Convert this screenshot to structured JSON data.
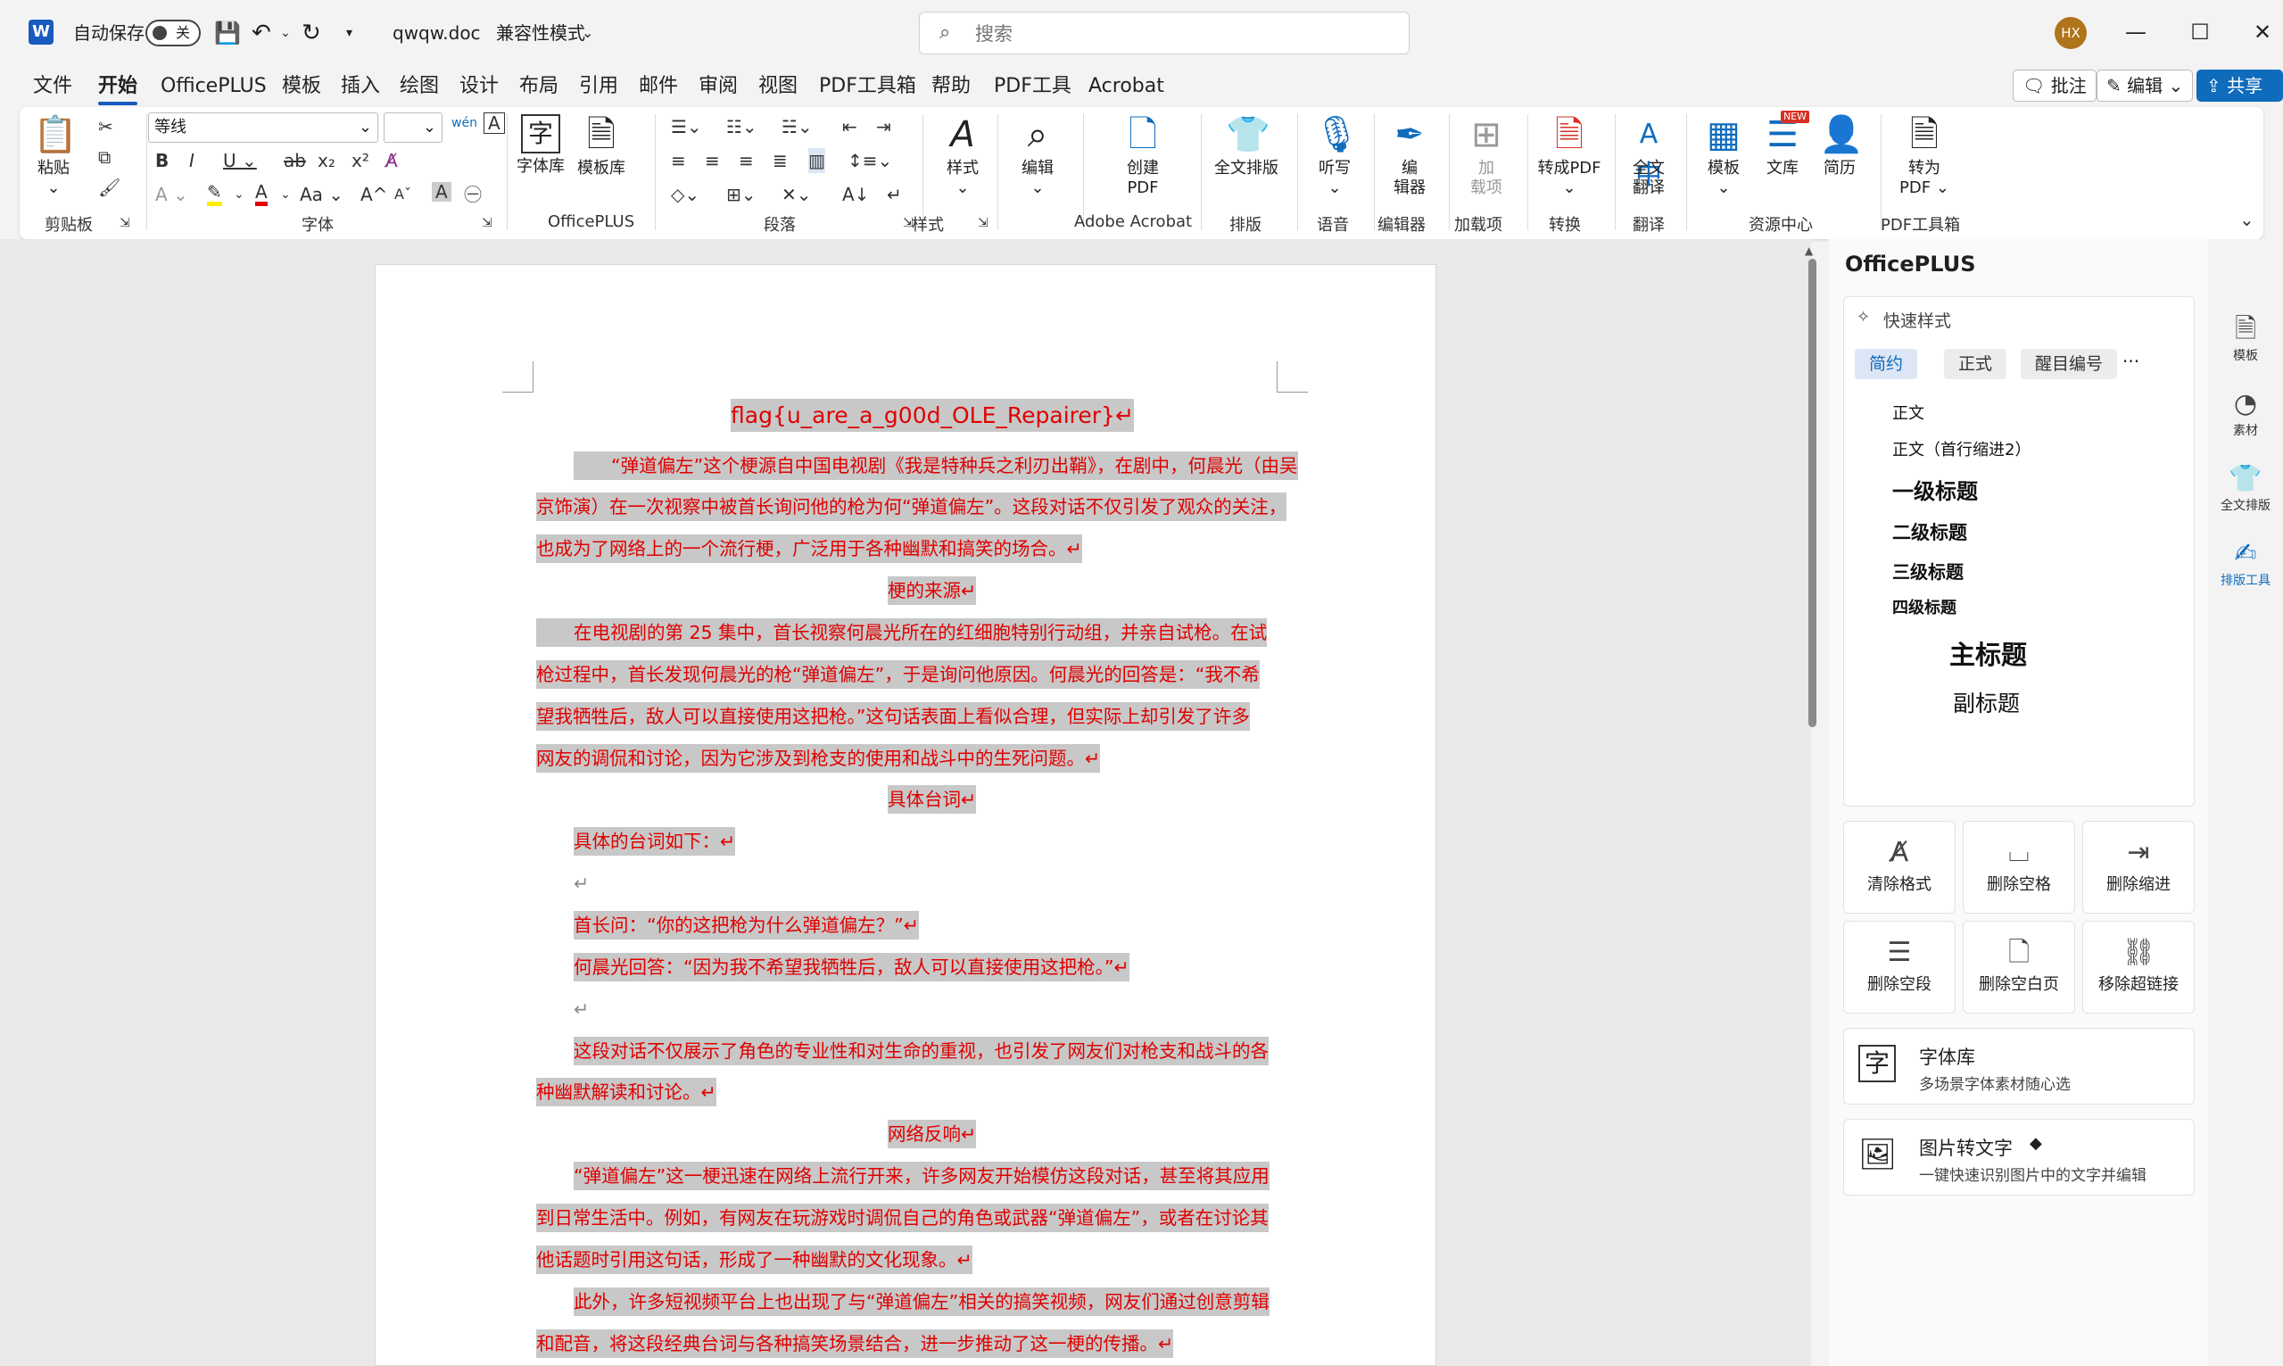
{
  "titlebar": {
    "autosave_label": "自动保存",
    "autosave_state": "关",
    "filename": "qwqw.doc",
    "mode": "兼容性模式",
    "search_placeholder": "搜索",
    "avatar_initials": "HX"
  },
  "menu": {
    "tabs": [
      "文件",
      "开始",
      "OfficePLUS",
      "模板",
      "插入",
      "绘图",
      "设计",
      "布局",
      "引用",
      "邮件",
      "审阅",
      "视图",
      "PDF工具箱",
      "帮助",
      "PDF工具",
      "Acrobat"
    ],
    "active": "开始",
    "comment_btn": "批注",
    "edit_btn": "编辑",
    "share_btn": "共享"
  },
  "ribbon": {
    "clipboard": {
      "paste": "粘贴",
      "label": "剪贴板"
    },
    "font": {
      "name": "等线",
      "size": "",
      "label": "字体"
    },
    "officeplus": {
      "fontlib": "字体库",
      "templatelib": "模板库",
      "label": "OfficePLUS"
    },
    "paragraph": {
      "label": "段落"
    },
    "styles": {
      "btn": "样式",
      "label": "样式"
    },
    "editing": {
      "btn": "编辑"
    },
    "acrobat": {
      "btn_line1": "创建",
      "btn_line2": "PDF",
      "label": "Adobe Acrobat"
    },
    "layout": {
      "btn": "全文排版",
      "label": "排版"
    },
    "voice": {
      "btn": "听写",
      "label": "语音"
    },
    "editor": {
      "btn_line1": "编",
      "btn_line2": "辑器",
      "label": "编辑器"
    },
    "addins": {
      "btn_line1": "加",
      "btn_line2": "载项",
      "label": "加载项"
    },
    "convert": {
      "btn": "转成PDF",
      "label": "转换"
    },
    "translate": {
      "btn_line1": "全文",
      "btn_line2": "翻译",
      "label": "翻译"
    },
    "resources": {
      "templates": "模板",
      "library": "文库",
      "resume": "简历",
      "label": "资源中心",
      "new_badge": "NEW"
    },
    "pdftools": {
      "btn_line1": "转为",
      "btn_line2": "PDF",
      "label": "PDF工具箱"
    }
  },
  "document": {
    "lines": [
      {
        "text": "flag{u_are_a_g00d_OLE_Repairer}↵"
      },
      {
        "text": "“弹道偏左”这个梗源自中国电视剧《我是特种兵之利刃出鞘》，在剧中，何晨光（由吴"
      },
      {
        "text": "京饰演）在一次视察中被首长询问他的枪为何“弹道偏左”。这段对话不仅引发了观众的关注，"
      },
      {
        "text": "也成为了网络上的一个流行梗，广泛用于各种幽默和搞笑的场合。↵"
      },
      {
        "text": "梗的来源↵"
      },
      {
        "text": "在电视剧的第 25 集中，首长视察何晨光所在的红细胞特别行动组，并亲自试枪。在试"
      },
      {
        "text": "枪过程中，首长发现何晨光的枪“弹道偏左”，于是询问他原因。何晨光的回答是：“我不希"
      },
      {
        "text": "望我牺牲后，敌人可以直接使用这把枪。”这句话表面上看似合理，但实际上却引发了许多"
      },
      {
        "text": "网友的调侃和讨论，因为它涉及到枪支的使用和战斗中的生死问题。↵"
      },
      {
        "text": "具体台词↵"
      },
      {
        "text": "具体的台词如下：↵"
      },
      {
        "text": "↵"
      },
      {
        "text": "首长问：“你的这把枪为什么弹道偏左？”↵"
      },
      {
        "text": "何晨光回答：“因为我不希望我牺牲后，敌人可以直接使用这把枪。”↵"
      },
      {
        "text": "↵"
      },
      {
        "text": "这段对话不仅展示了角色的专业性和对生命的重视，也引发了网友们对枪支和战斗的各"
      },
      {
        "text": "种幽默解读和讨论。↵"
      },
      {
        "text": "网络反响↵"
      },
      {
        "text": "“弹道偏左”这一梗迅速在网络上流行开来，许多网友开始模仿这段对话，甚至将其应用"
      },
      {
        "text": "到日常生活中。例如，有网友在玩游戏时调侃自己的角色或武器“弹道偏左”，或者在讨论其"
      },
      {
        "text": "他话题时引用这句话，形成了一种幽默的文化现象。↵"
      },
      {
        "text": "此外，许多短视频平台上也出现了与“弹道偏左”相关的搞笑视频，网友们通过创意剪辑"
      },
      {
        "text": "和配音，将这段经典台词与各种搞笑场景结合，进一步推动了这一梗的传播。↵"
      }
    ]
  },
  "pane": {
    "title": "OfficePLUS",
    "quick_styles": "快速样式",
    "style_tabs": [
      "简约",
      "正式",
      "醒目编号"
    ],
    "more": "···",
    "styles": [
      "正文",
      "正文（首行缩进2）",
      "一级标题",
      "二级标题",
      "三级标题",
      "四级标题",
      "主标题",
      "副标题"
    ],
    "tools": [
      "清除格式",
      "删除空格",
      "删除缩进",
      "删除空段",
      "删除空白页",
      "移除超链接"
    ],
    "fontlib_title": "字体库",
    "fontlib_desc": "多场景字体素材随心选",
    "ocr_title": "图片转文字",
    "ocr_desc": "一键快速识别图片中的文字并编辑"
  },
  "rail": [
    "模板",
    "素材",
    "全文排版",
    "排版工具"
  ]
}
